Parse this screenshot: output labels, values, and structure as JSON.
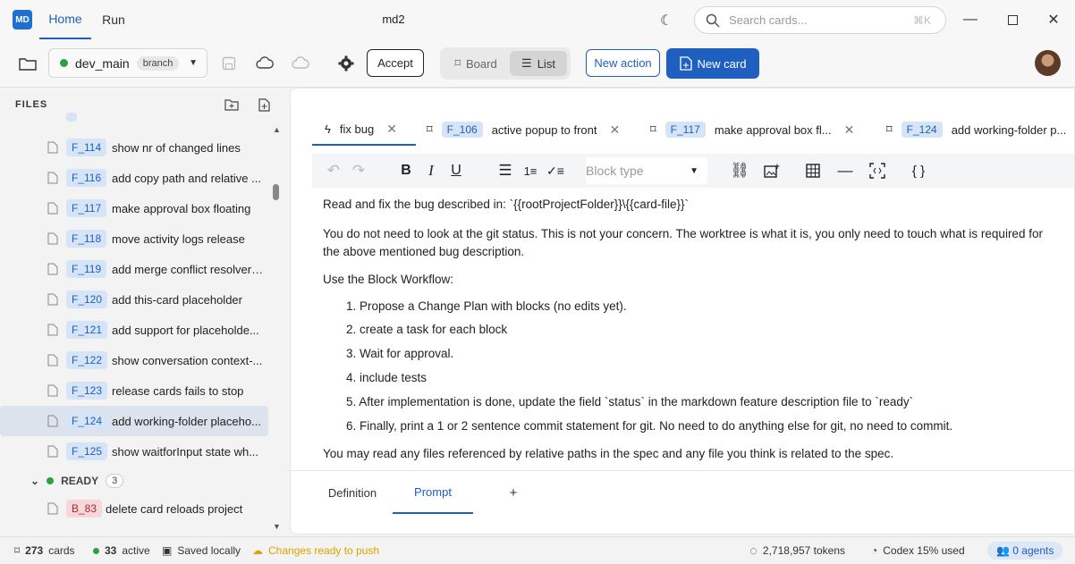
{
  "app": {
    "logo_text": "MD",
    "title": "md2"
  },
  "nav": {
    "home": "Home",
    "run": "Run"
  },
  "search": {
    "placeholder": "Search cards...",
    "shortcut": "⌘K"
  },
  "toolbar": {
    "branch_name": "dev_main",
    "branch_tag": "branch",
    "accept_label": "Accept",
    "board_label": "Board",
    "list_label": "List",
    "new_action_label": "New action",
    "new_card_label": "New card"
  },
  "sidebar": {
    "header": "FILES",
    "items": [
      {
        "id": "F_114",
        "title": "show nr of changed lines"
      },
      {
        "id": "F_116",
        "title": "add copy path and relative ..."
      },
      {
        "id": "F_117",
        "title": "make approval box floating"
      },
      {
        "id": "F_118",
        "title": "move activity logs release"
      },
      {
        "id": "F_119",
        "title": "add merge conflict resolver ..."
      },
      {
        "id": "F_120",
        "title": "add this-card placeholder"
      },
      {
        "id": "F_121",
        "title": "add support for placeholde..."
      },
      {
        "id": "F_122",
        "title": "show conversation context-..."
      },
      {
        "id": "F_123",
        "title": "release cards fails to stop"
      },
      {
        "id": "F_124",
        "title": "add working-folder placeho..."
      },
      {
        "id": "F_125",
        "title": "show waitforInput state wh..."
      }
    ],
    "ready_group": {
      "label": "READY",
      "count": "3"
    },
    "ready_items": [
      {
        "id": "B_83",
        "title": "delete card reloads project"
      }
    ]
  },
  "tabs": [
    {
      "badge": "",
      "title": "fix bug"
    },
    {
      "badge": "F_106",
      "title": "active popup to front"
    },
    {
      "badge": "F_117",
      "title": "make approval box fl..."
    },
    {
      "badge": "F_124",
      "title": "add working-folder p..."
    }
  ],
  "editor": {
    "block_type_placeholder": "Block type",
    "paragraphs": {
      "p1": "Read and fix the bug described in: `{{rootProjectFolder}}\\{{card-file}}`",
      "p2a": "You do not need to look at the git status. This is not your concern.  The worktree is what it is, you only need to touch what is required for",
      "p2b": "the above mentioned bug description.",
      "p3": "Use the Block Workflow:",
      "p4": "You may read any files referenced by relative paths in the spec and any file you think is related to the spec."
    },
    "list": [
      "1. Propose a Change Plan with blocks (no edits yet).",
      "2. create a task for each block",
      "3. Wait for approval.",
      "4. include tests",
      "5. After implementation is done, update the field `status` in the markdown feature description file to `ready`",
      "6. Finally, print a 1 or 2 sentence commit statement for git. No need to do anything else for git, no need to commit."
    ]
  },
  "bottom_tabs": {
    "definition": "Definition",
    "prompt": "Prompt",
    "add": "+"
  },
  "status": {
    "cards_count": "273",
    "cards_label": "cards",
    "active_count": "33",
    "active_label": "active",
    "saved": "Saved locally",
    "changes": "Changes ready to push",
    "tokens": "2,718,957 tokens",
    "codex": "Codex 15% used",
    "agents": "0 agents"
  },
  "colors": {
    "accent": "#1f5fbf",
    "ready_dot": "#2ea043",
    "changes": "#e0a100"
  }
}
